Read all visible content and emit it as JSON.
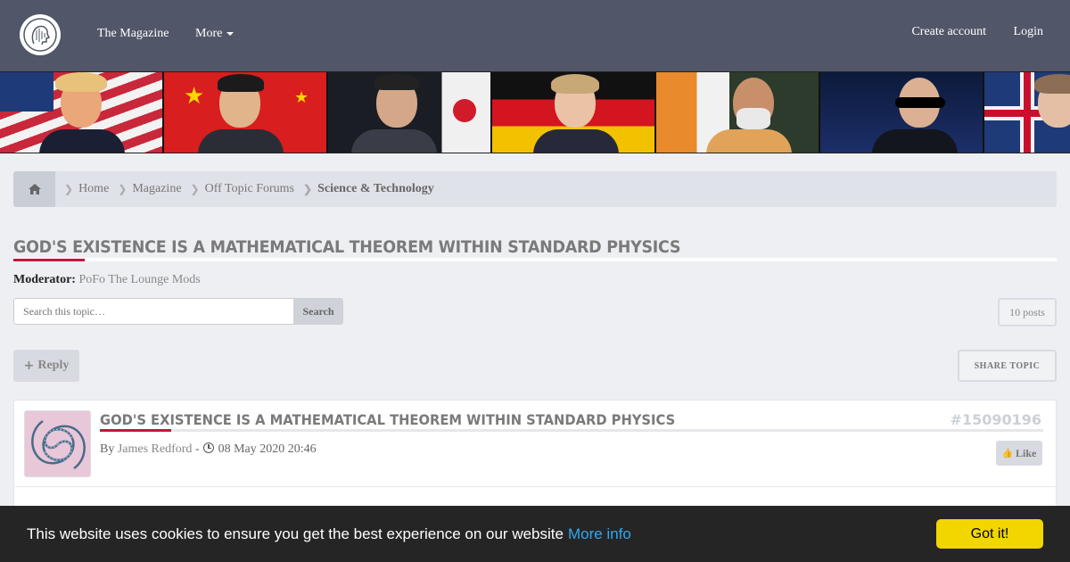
{
  "nav": {
    "magazine": "The Magazine",
    "more": "More",
    "create_account": "Create account",
    "login": "Login"
  },
  "banner": {
    "panels": [
      "us-leader",
      "china-leader",
      "japan-leader",
      "germany-leader",
      "india-leader",
      "russia-leader",
      "uk-leader"
    ]
  },
  "breadcrumb": {
    "items": [
      "Home",
      "Magazine",
      "Off Topic Forums",
      "Science & Technology"
    ]
  },
  "topic": {
    "title": "GOD'S EXISTENCE IS A MATHEMATICAL THEOREM WITHIN STANDARD PHYSICS",
    "moderator_label": "Moderator:",
    "moderator_value": "PoFo The Lounge Mods"
  },
  "search": {
    "placeholder": "Search this topic…",
    "button": "Search"
  },
  "posts_count": "10 posts",
  "actions": {
    "reply": "Reply",
    "share": "SHARE TOPIC"
  },
  "post": {
    "title": "GOD'S EXISTENCE IS A MATHEMATICAL THEOREM WITHIN STANDARD PHYSICS",
    "id": "#15090196",
    "by": "By",
    "author": "James Redford",
    "separator": "-",
    "date": "08 May 2020 20:46",
    "like": "Like"
  },
  "cookie": {
    "text": "This website uses cookies to ensure you get the best experience on our website",
    "link": "More info",
    "button": "Got it!"
  },
  "colors": {
    "nav_bg": "#515769",
    "accent": "#c2173a",
    "cookie_bg": "#252525",
    "cookie_button": "#f1d600",
    "cookie_link": "#31a8f0"
  }
}
